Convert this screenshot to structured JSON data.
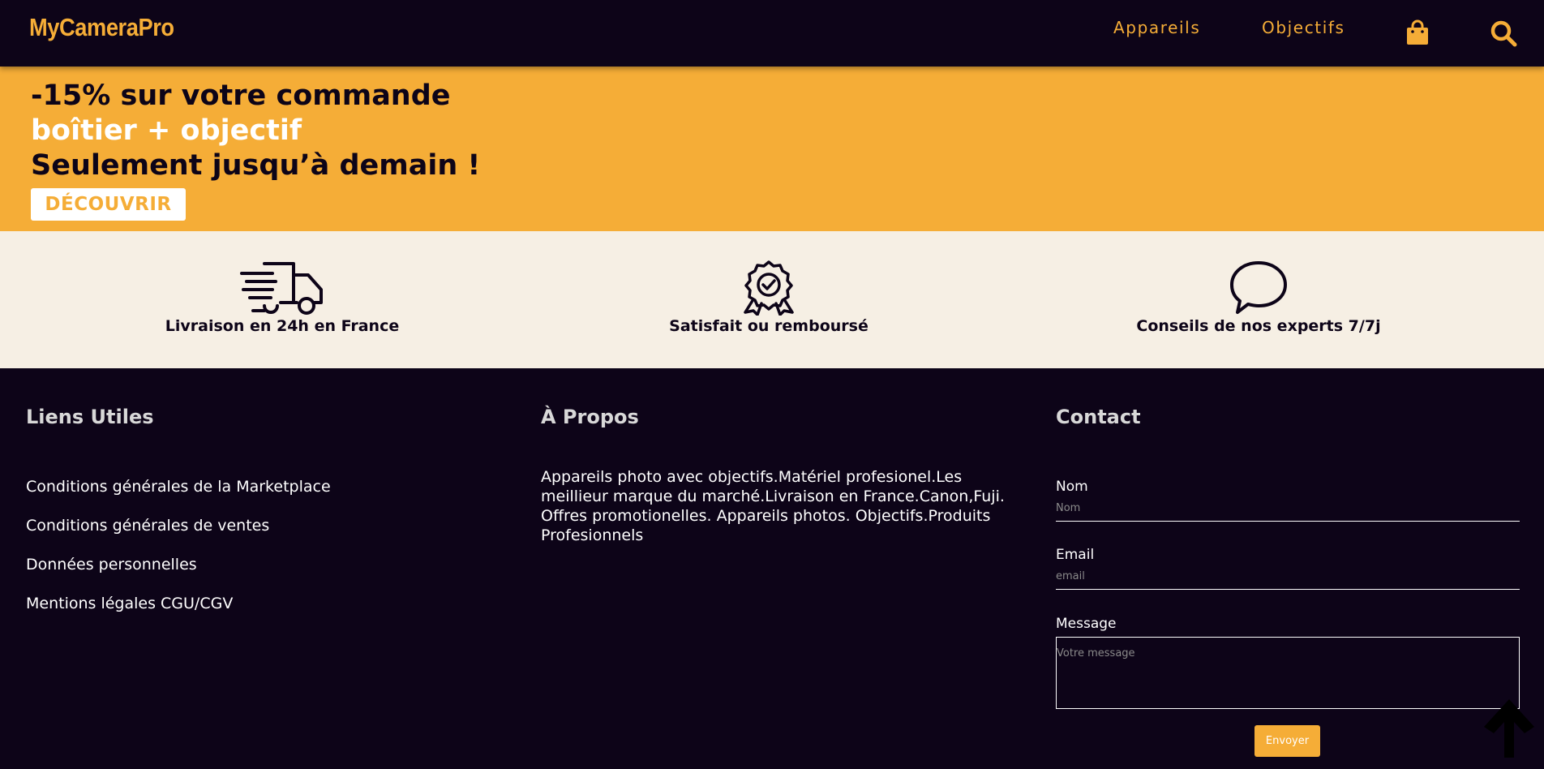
{
  "header": {
    "logo": "MyCameraPro",
    "nav": [
      {
        "label": "Appareils"
      },
      {
        "label": "Objectifs"
      }
    ],
    "icons": [
      "shopping-bag-icon",
      "search-icon"
    ]
  },
  "promo": {
    "line1": "-15% sur votre commande",
    "line2": "boîtier + objectif",
    "line3": "Seulement jusqu’à demain !",
    "button_label": "DÉCOUVRIR"
  },
  "features": [
    {
      "icon": "delivery-truck-icon",
      "label": "Livraison en 24h en France"
    },
    {
      "icon": "award-badge-icon",
      "label": "Satisfait ou remboursé"
    },
    {
      "icon": "speech-bubble-icon",
      "label": "Conseils de nos experts 7/7j"
    }
  ],
  "footer": {
    "links_title": "Liens Utiles",
    "links": [
      {
        "label": "Conditions générales de la Marketplace"
      },
      {
        "label": "Conditions générales de ventes"
      },
      {
        "label": "Données personnelles"
      },
      {
        "label": "Mentions légales CGU/CGV"
      }
    ],
    "about_title": "À Propos",
    "about_text": "Appareils photo avec objectifs.Matériel profesionel.Les meillieur marque du marché.Livraison en France.Canon,Fuji. Offres promotionelles. Appareils photos. Objectifs.Produits Profesionnels",
    "contact_title": "Contact",
    "form": {
      "name_label": "Nom",
      "name_placeholder": "Nom",
      "email_label": "Email",
      "email_placeholder": "email",
      "message_label": "Message",
      "message_placeholder": "Votre message",
      "submit_label": "Envoyer"
    }
  },
  "colors": {
    "accent": "#f5ad37",
    "dark": "#0d0418",
    "cream": "#f6efe4"
  },
  "scroll_top_icon": "arrow-up-icon"
}
